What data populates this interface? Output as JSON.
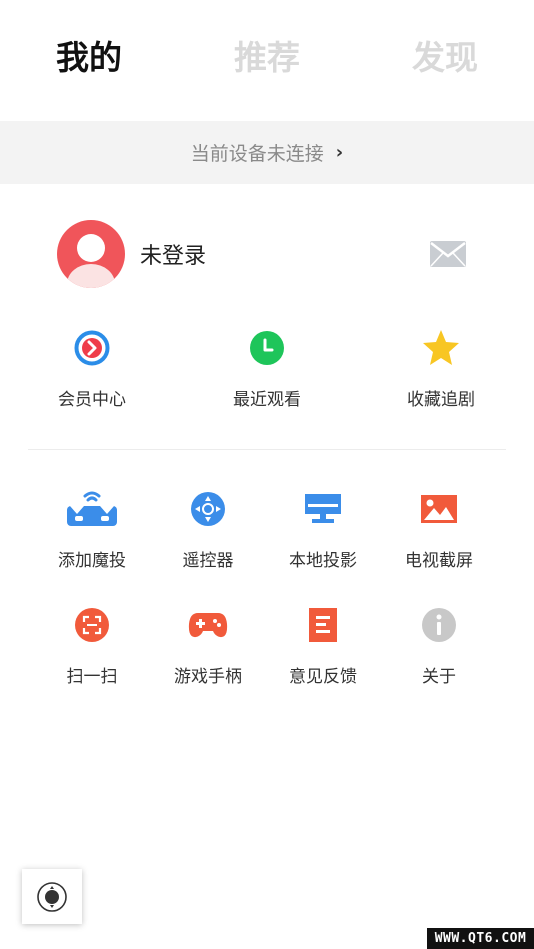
{
  "tabs": [
    {
      "label": "我的"
    },
    {
      "label": "推荐"
    },
    {
      "label": "发现"
    }
  ],
  "device_bar": {
    "text": "当前设备未连接",
    "chevron": "›"
  },
  "profile": {
    "status": "未登录",
    "avatar_icon": "avatar-icon",
    "mail_icon": "mail-icon"
  },
  "quick_actions": [
    {
      "label": "会员中心",
      "icon": "vip-play-icon",
      "color": "#2b8de8"
    },
    {
      "label": "最近观看",
      "icon": "clock-icon",
      "color": "#1ec55a"
    },
    {
      "label": "收藏追剧",
      "icon": "star-icon",
      "color": "#f8c623"
    }
  ],
  "tools": [
    {
      "label": "添加魔投",
      "icon": "device-wifi-icon",
      "color": "#3b8de9"
    },
    {
      "label": "遥控器",
      "icon": "remote-dpad-icon",
      "color": "#3b8de9"
    },
    {
      "label": "本地投影",
      "icon": "monitor-icon",
      "color": "#3b8de9"
    },
    {
      "label": "电视截屏",
      "icon": "image-icon",
      "color": "#f15a3b"
    },
    {
      "label": "扫一扫",
      "icon": "scan-icon",
      "color": "#f15a3b"
    },
    {
      "label": "游戏手柄",
      "icon": "gamepad-icon",
      "color": "#f15a3b"
    },
    {
      "label": "意见反馈",
      "icon": "document-icon",
      "color": "#f15a3b"
    },
    {
      "label": "关于",
      "icon": "info-icon",
      "color": "#c8c8c8"
    }
  ],
  "watermark": "WWW.QT6.COM",
  "colors": {
    "active_tab": "#111111",
    "inactive_tab": "#d9d9d9",
    "avatar_bg": "#f0555a",
    "device_bar_bg": "#f3f3f3"
  }
}
